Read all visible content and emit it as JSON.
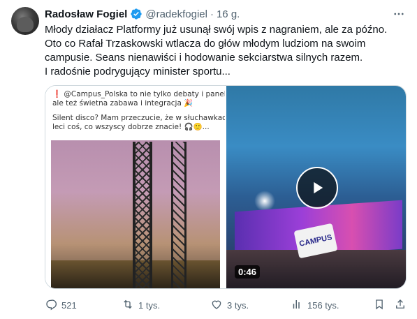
{
  "tweet": {
    "author_name": "Radosław Fogiel",
    "handle": "@radekfogiel",
    "separator": "·",
    "time": "16 g.",
    "text_lines": [
      "Młody działacz Platformy już usunął swój wpis z nagraniem, ale za późno.",
      "Oto co Rafał Trzaskowski wtlacza do głów młodym ludziom na swoim",
      "campusie. Seans nienawiści i hodowanie sekciarstwa silnych razem.",
      "I radośnie podrygujący minister sportu..."
    ]
  },
  "media": {
    "left_caption": {
      "line1": "❗ @Campus_Polska to nie tylko debaty i panele,",
      "line2": "ale też świetna zabawa i integracja 🎉",
      "line3": "Silent disco? Mam przeczucie, że w słuchawkach",
      "line4": "leci coś, co wszyscy dobrze znacie! 🎧🙂..."
    },
    "sign_text": "CAMPUS",
    "duration": "0:46"
  },
  "actions": {
    "replies": "521",
    "retweets": "1 tys.",
    "likes": "3 tys.",
    "views": "156 tys."
  },
  "colors": {
    "verified": "#1d9bf0",
    "secondary_text": "#536471",
    "primary_text": "#0f1419"
  },
  "icons": [
    "verified-badge-icon",
    "more-icon",
    "play-icon",
    "reply-icon",
    "retweet-icon",
    "like-icon",
    "views-icon",
    "bookmark-icon",
    "share-icon"
  ]
}
